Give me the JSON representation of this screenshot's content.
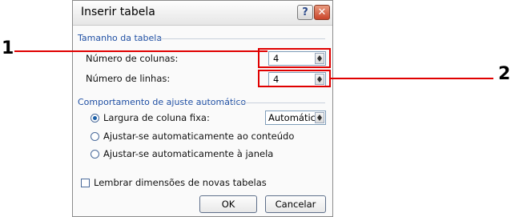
{
  "dialog": {
    "title": "Inserir tabela",
    "help_label": "?",
    "close_label": "✕"
  },
  "table_size": {
    "group_title": "Tamanho da tabela",
    "columns_label": "Número de colunas:",
    "columns_value": "4",
    "rows_label": "Número de linhas:",
    "rows_value": "4"
  },
  "autofit": {
    "group_title": "Comportamento de ajuste automático",
    "fixed_width_label": "Largura de coluna fixa:",
    "fixed_width_value": "Automático",
    "autofit_contents_label": "Ajustar-se automaticamente ao conteúdo",
    "autofit_window_label": "Ajustar-se automaticamente à janela",
    "selected": "fixed_width"
  },
  "remember_label": "Lembrar dimensões de novas tabelas",
  "remember_checked": false,
  "buttons": {
    "ok": "OK",
    "cancel": "Cancelar"
  },
  "callouts": {
    "one": "1",
    "two": "2"
  },
  "colors": {
    "accent": "#1f4fa3",
    "callout": "#e00000"
  }
}
